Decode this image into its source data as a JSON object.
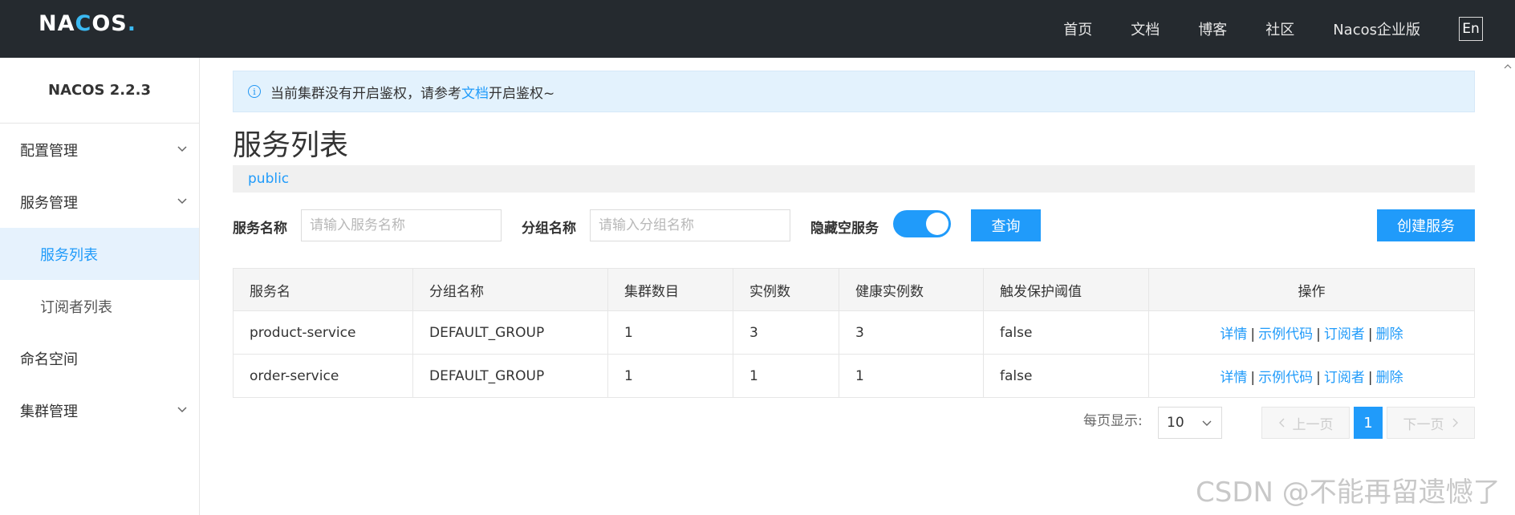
{
  "header": {
    "logo_left": "NA",
    "logo_c": "C",
    "logo_right": "OS",
    "logo_dot": ".",
    "nav": [
      "首页",
      "文档",
      "博客",
      "社区",
      "Nacos企业版"
    ],
    "lang": "En"
  },
  "sidebar": {
    "version": "NACOS 2.2.3",
    "items": [
      {
        "label": "配置管理"
      },
      {
        "label": "服务管理"
      },
      {
        "label": "服务列表"
      },
      {
        "label": "订阅者列表"
      },
      {
        "label": "命名空间"
      },
      {
        "label": "集群管理"
      }
    ]
  },
  "notice": {
    "prefix": "当前集群没有开启鉴权，请参考",
    "link": "文档",
    "suffix": "开启鉴权~"
  },
  "page": {
    "title": "服务列表",
    "namespace": "public"
  },
  "filters": {
    "service_name_label": "服务名称",
    "service_name_placeholder": "请输入服务名称",
    "group_name_label": "分组名称",
    "group_name_placeholder": "请输入分组名称",
    "hide_empty_label": "隐藏空服务",
    "query_button": "查询",
    "create_button": "创建服务"
  },
  "table": {
    "headers": [
      "服务名",
      "分组名称",
      "集群数目",
      "实例数",
      "健康实例数",
      "触发保护阈值",
      "操作"
    ],
    "rows": [
      [
        "product-service",
        "DEFAULT_GROUP",
        "1",
        "3",
        "3",
        "false"
      ],
      [
        "order-service",
        "DEFAULT_GROUP",
        "1",
        "1",
        "1",
        "false"
      ]
    ],
    "ops": [
      "详情",
      "示例代码",
      "订阅者",
      "删除"
    ]
  },
  "pagination": {
    "per_page_label": "每页显示:",
    "per_page_value": "10",
    "prev": "上一页",
    "current": "1",
    "next": "下一页"
  },
  "watermark": "CSDN @不能再留遗憾了"
}
